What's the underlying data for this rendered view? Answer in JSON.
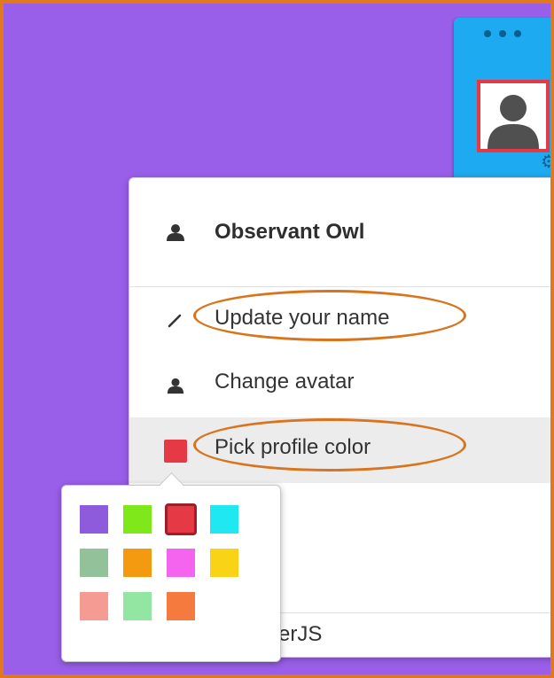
{
  "user": {
    "name": "Observant Owl"
  },
  "menu": {
    "items": [
      {
        "label": "Update your name",
        "icon": "pencil-icon"
      },
      {
        "label": "Change avatar",
        "icon": "avatar-icon"
      },
      {
        "label": "Pick profile color",
        "icon": "color-swatch-icon"
      }
    ],
    "footer_label": "TogetherJS"
  },
  "profile_color": "#e53a46",
  "color_picker": {
    "swatches": [
      "#8e5bdc",
      "#7ee81a",
      "#e53a46",
      "#1fe8f0",
      "#93c29a",
      "#f39a10",
      "#f564ef",
      "#f8d316",
      "#f59b93",
      "#93e6a1",
      "#f47a3e"
    ],
    "selected_index": 2
  },
  "colors": {
    "page_background": "#9a5fe9",
    "frame_border": "#e0781e",
    "dock_background": "#1eaaf0",
    "annotation": "#d9731c",
    "highlight_row": "#ececec"
  }
}
